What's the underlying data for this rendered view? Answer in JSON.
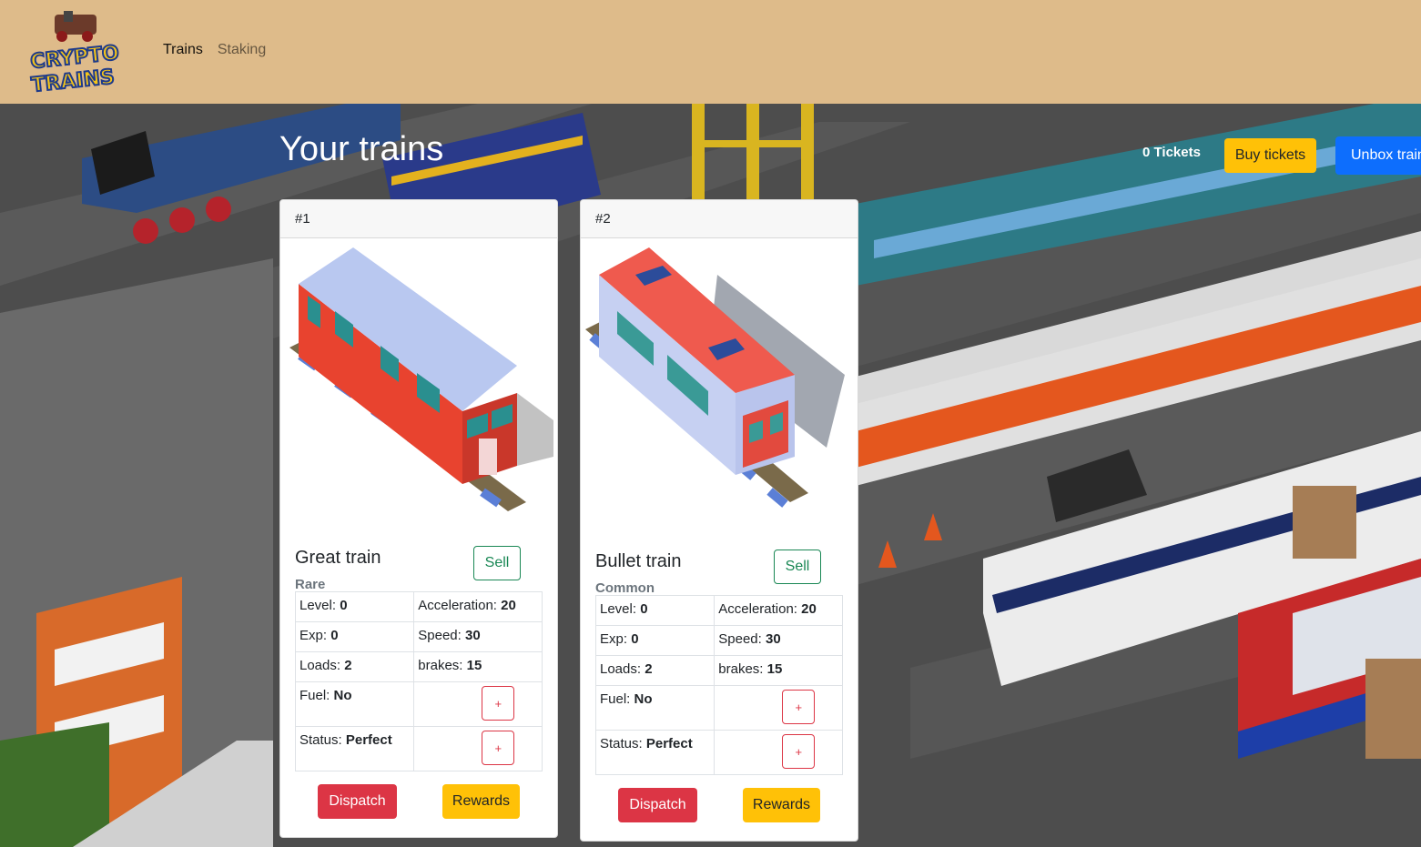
{
  "nav": {
    "logo_line1": "CRYPTO",
    "logo_line2": "TRAINS",
    "links": [
      "Trains",
      "Staking"
    ]
  },
  "header": {
    "title": "Your trains",
    "tickets": "0 Tickets",
    "buy_label": "Buy tickets",
    "unbox_label": "Unbox train"
  },
  "trains": [
    {
      "id": "#1",
      "name": "Great train",
      "rarity": "Rare",
      "sell_label": "Sell",
      "level_label": "Level:",
      "level": "0",
      "accel_label": "Acceleration:",
      "accel": "20",
      "exp_label": "Exp:",
      "exp": "0",
      "speed_label": "Speed:",
      "speed": "30",
      "loads_label": "Loads:",
      "loads": "2",
      "brakes_label": "brakes:",
      "brakes": "15",
      "fuel_label": "Fuel:",
      "fuel": "No",
      "status_label": "Status:",
      "status": "Perfect",
      "plus_label": "+",
      "dispatch_label": "Dispatch",
      "rewards_label": "Rewards"
    },
    {
      "id": "#2",
      "name": "Bullet train",
      "rarity": "Common",
      "sell_label": "Sell",
      "level_label": "Level:",
      "level": "0",
      "accel_label": "Acceleration:",
      "accel": "20",
      "exp_label": "Exp:",
      "exp": "0",
      "speed_label": "Speed:",
      "speed": "30",
      "loads_label": "Loads:",
      "loads": "2",
      "brakes_label": "brakes:",
      "brakes": "15",
      "fuel_label": "Fuel:",
      "fuel": "No",
      "status_label": "Status:",
      "status": "Perfect",
      "plus_label": "+",
      "dispatch_label": "Dispatch",
      "rewards_label": "Rewards"
    }
  ],
  "colors": {
    "navbar": "#debb8a",
    "primary": "#0d6efd",
    "warning": "#ffc107",
    "danger": "#dc3545",
    "success": "#198754"
  }
}
